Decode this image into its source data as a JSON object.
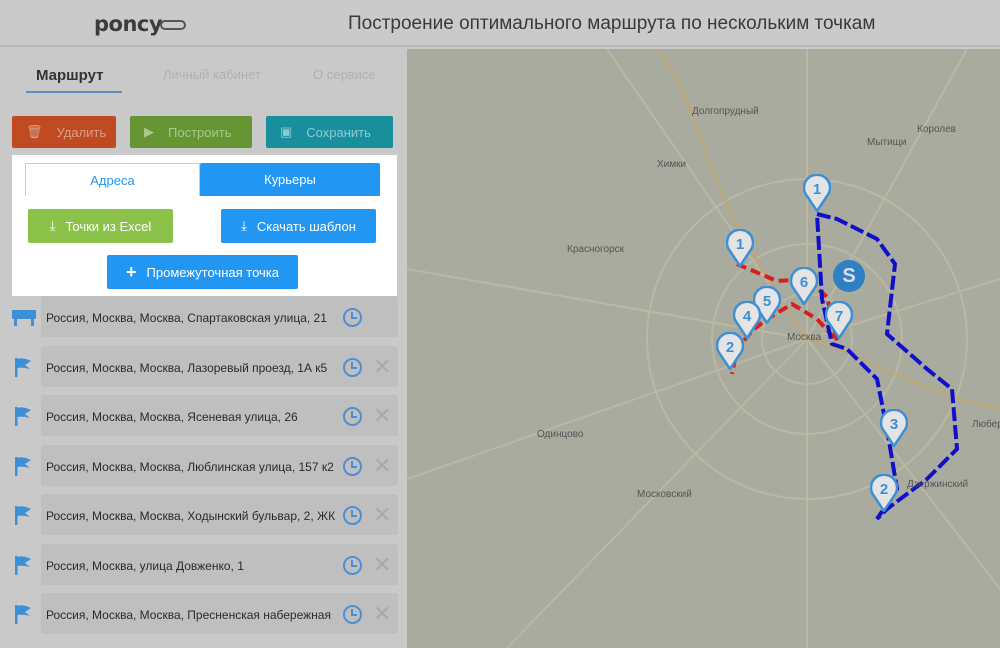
{
  "header": {
    "logo": "poncy",
    "title": "Построение оптимального маршрута по нескольким точкам"
  },
  "nav": {
    "tabs": [
      "Маршрут",
      "Личный кабинет",
      "О сервисе"
    ],
    "active": 0
  },
  "actions": {
    "delete": "Удалить",
    "build": "Построить",
    "save": "Сохранить"
  },
  "panel": {
    "tabs": [
      "Адреса",
      "Курьеры"
    ],
    "excel": "Точки из Excel",
    "template": "Скачать шаблон",
    "waypoint": "Промежуточная точка"
  },
  "points": [
    {
      "icon": "start-icon",
      "address": "Россия, Москва, Москва, Спартаковская улица, 21",
      "removable": false
    },
    {
      "icon": "flag-icon",
      "address": "Россия, Москва, Москва, Лазоревый проезд, 1А к5",
      "removable": true
    },
    {
      "icon": "flag-icon",
      "address": "Россия, Москва, Москва, Ясеневая улица, 26",
      "removable": true
    },
    {
      "icon": "flag-icon",
      "address": "Россия, Москва, Москва, Люблинская улица, 157 к2",
      "removable": true
    },
    {
      "icon": "flag-icon",
      "address": "Россия, Москва, Москва, Ходынский бульвар, 2, ЖК",
      "removable": true
    },
    {
      "icon": "flag-icon",
      "address": "Россия, Москва, улица Довженко, 1",
      "removable": true
    },
    {
      "icon": "flag-icon",
      "address": "Россия, Москва, Москва, Пресненская набережная",
      "removable": true
    }
  ],
  "map": {
    "labels": [
      "Долгопрудный",
      "Химки",
      "Мытищи",
      "Королев",
      "Красногорск",
      "Москва",
      "Одинцово",
      "Люберцы",
      "Московский",
      "Дзержинский"
    ],
    "route_colors": {
      "red": "#d62020",
      "blue": "#1010c8"
    },
    "pin_color": "#3d8fd6"
  }
}
